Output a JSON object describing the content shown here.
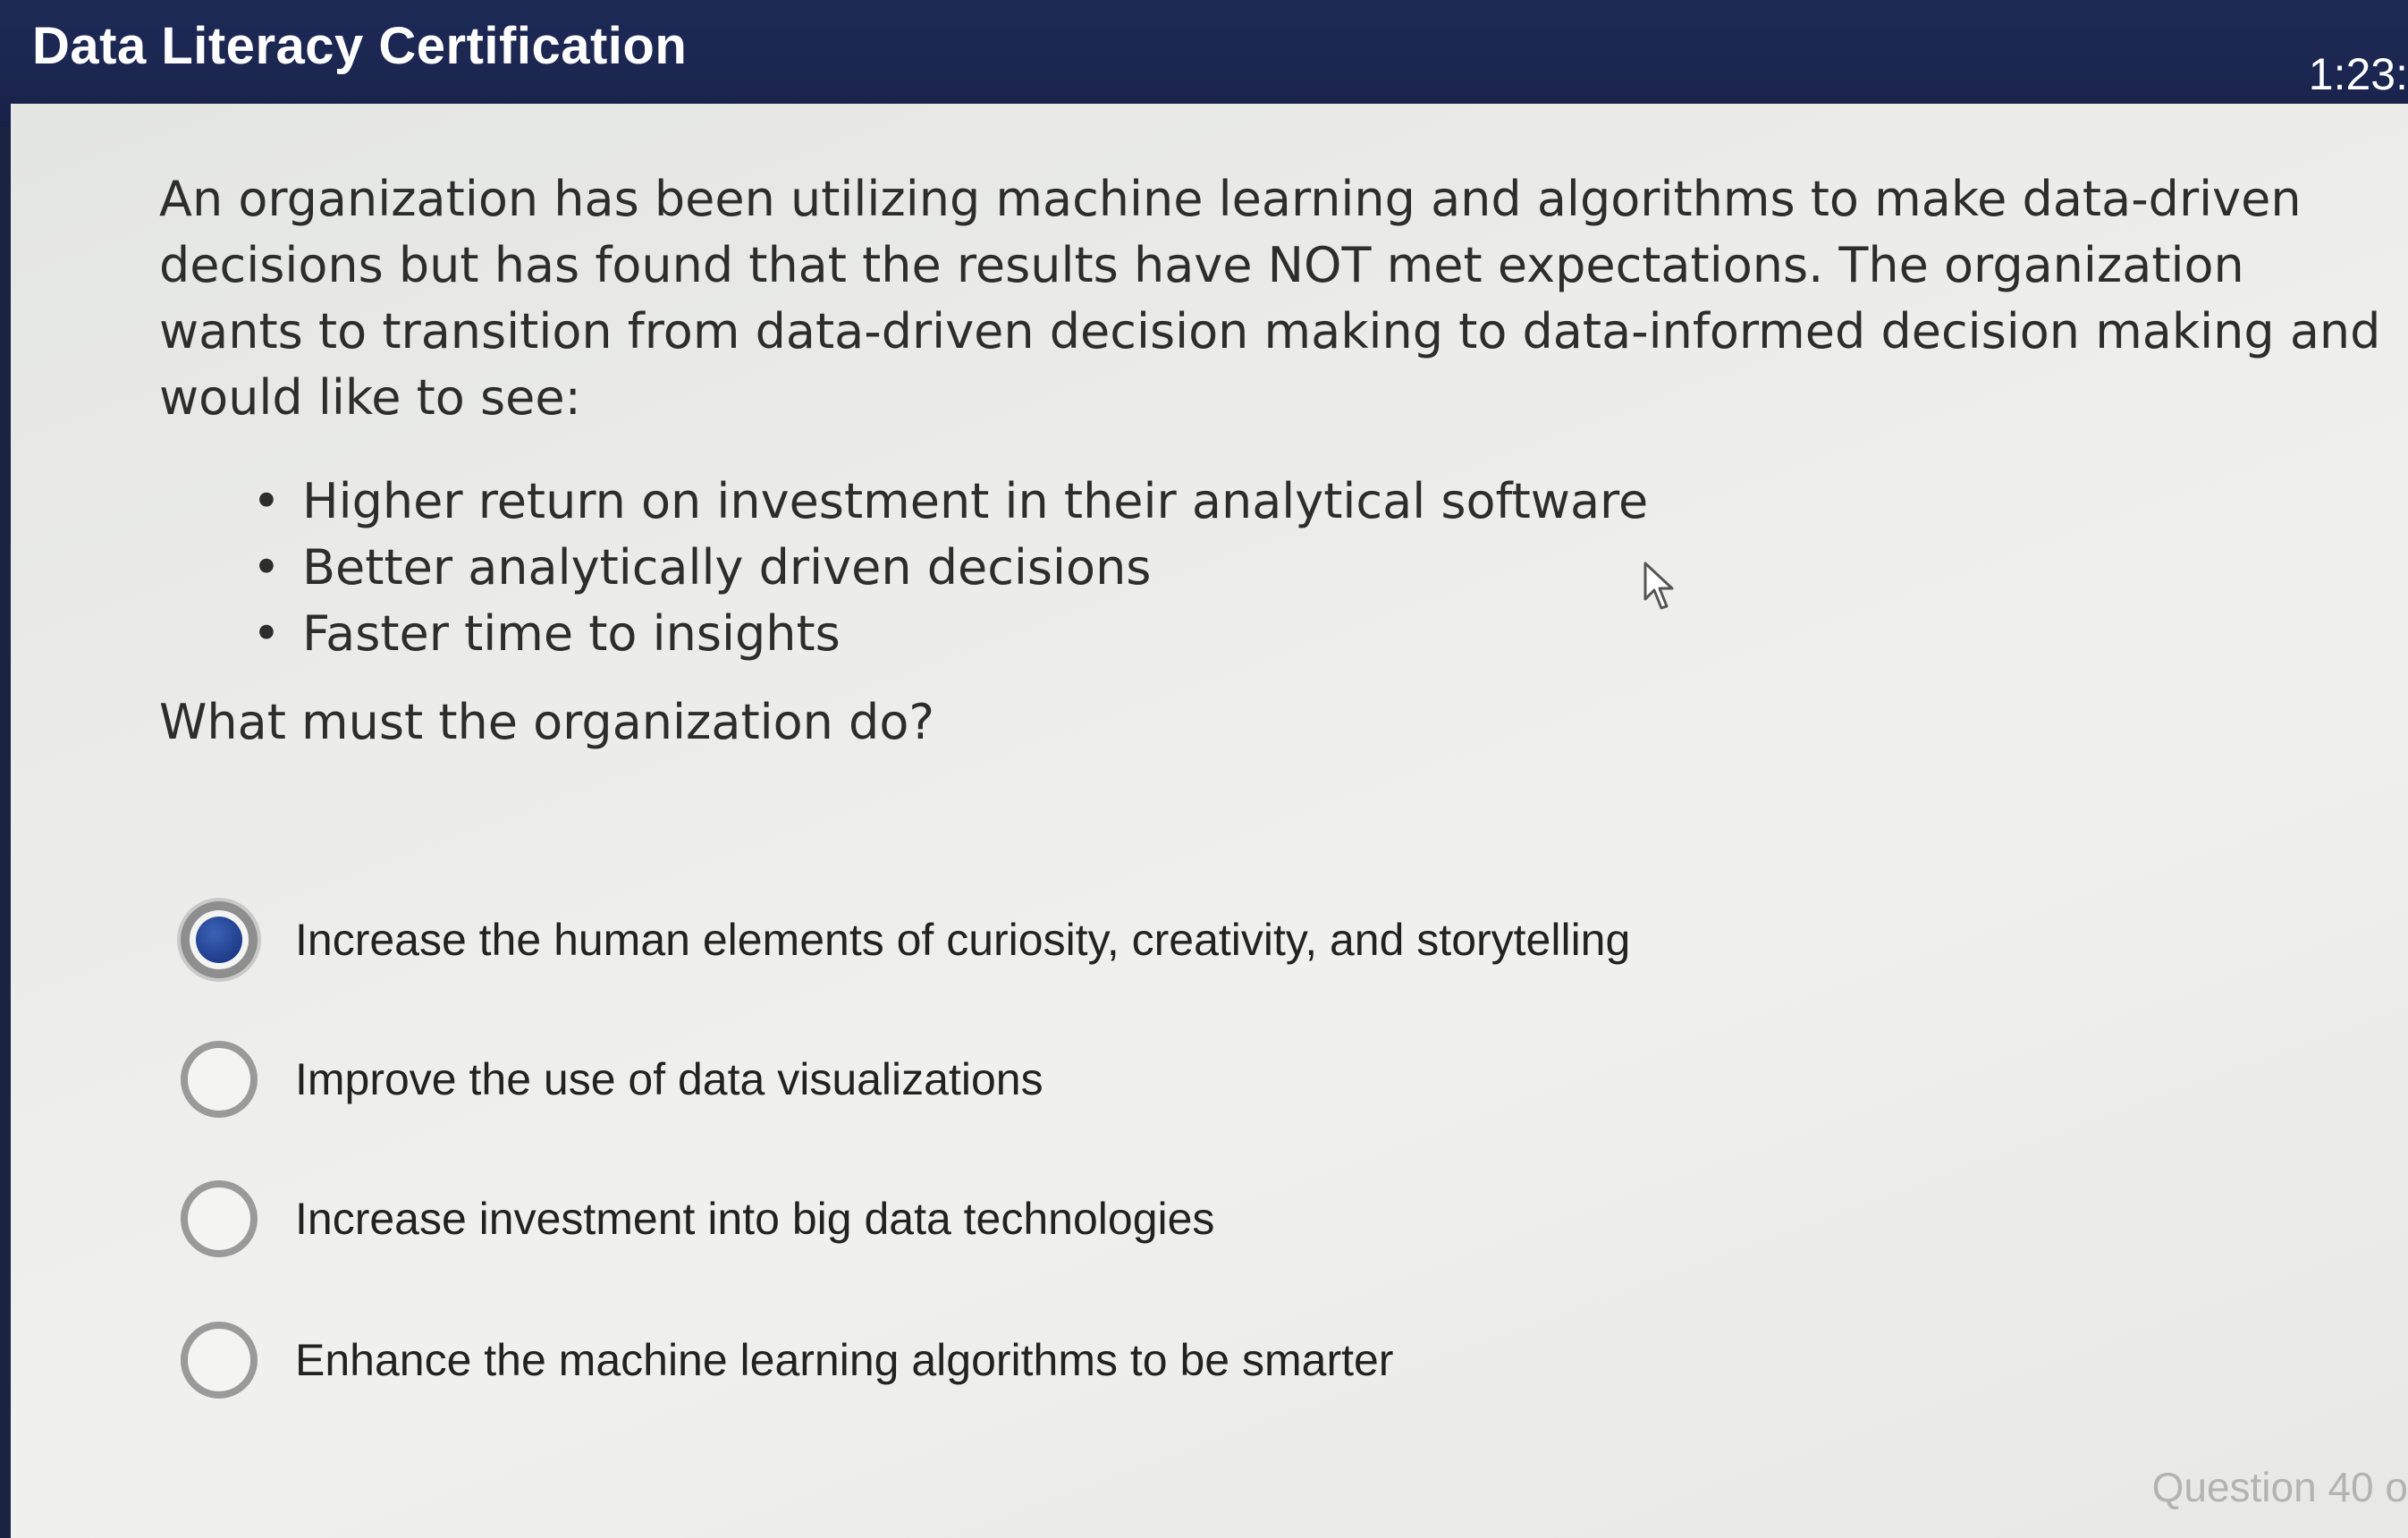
{
  "header": {
    "title": "Data Literacy Certification",
    "timer": "1:23:"
  },
  "question": {
    "text": "An organization has been utilizing machine learning and algorithms to make data-driven decisions but has found that the results have NOT met expectations.  The organization wants to transition from data-driven decision making to data-informed decision making and would like to see:",
    "bullets": [
      "Higher return on investment in their analytical software",
      "Better analytically driven decisions",
      "Faster time to insights"
    ],
    "prompt": "What must the organization do?"
  },
  "options": [
    {
      "label": "Increase the human elements of curiosity, creativity, and storytelling",
      "selected": true
    },
    {
      "label": "Improve the use of data visualizations",
      "selected": false
    },
    {
      "label": "Increase investment into big data technologies",
      "selected": false
    },
    {
      "label": "Enhance the machine learning algorithms to be smarter",
      "selected": false
    }
  ],
  "footer": {
    "progress": "Question 40 o"
  },
  "colors": {
    "header_bg": "#1b2651",
    "radio_selected": "#1f3d8a",
    "text": "#2d2d2d"
  },
  "icons": {
    "cursor": "mouse-pointer-icon"
  }
}
